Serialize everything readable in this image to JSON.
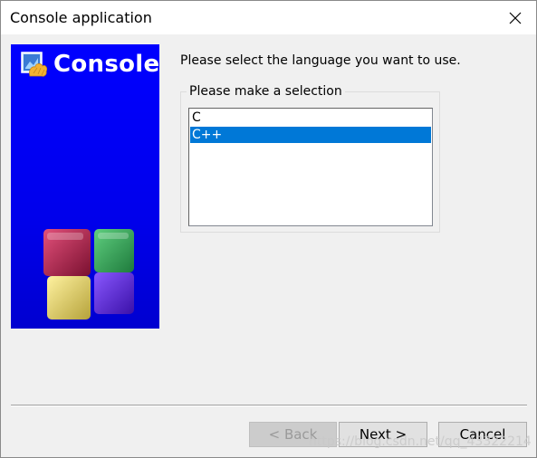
{
  "window": {
    "title": "Console application"
  },
  "banner": {
    "title": "Console"
  },
  "main": {
    "prompt": "Please select the language you want to use.",
    "group_label": "Please make a selection",
    "languages": [
      {
        "label": "C",
        "selected": false
      },
      {
        "label": "C++",
        "selected": true
      }
    ]
  },
  "buttons": {
    "back": "< Back",
    "next": "Next >",
    "cancel": "Cancel"
  },
  "watermark": "https://blog.csdn.net/qq_43322214",
  "colors": {
    "banner_blue": "#0000ff",
    "selection": "#0078d7"
  }
}
